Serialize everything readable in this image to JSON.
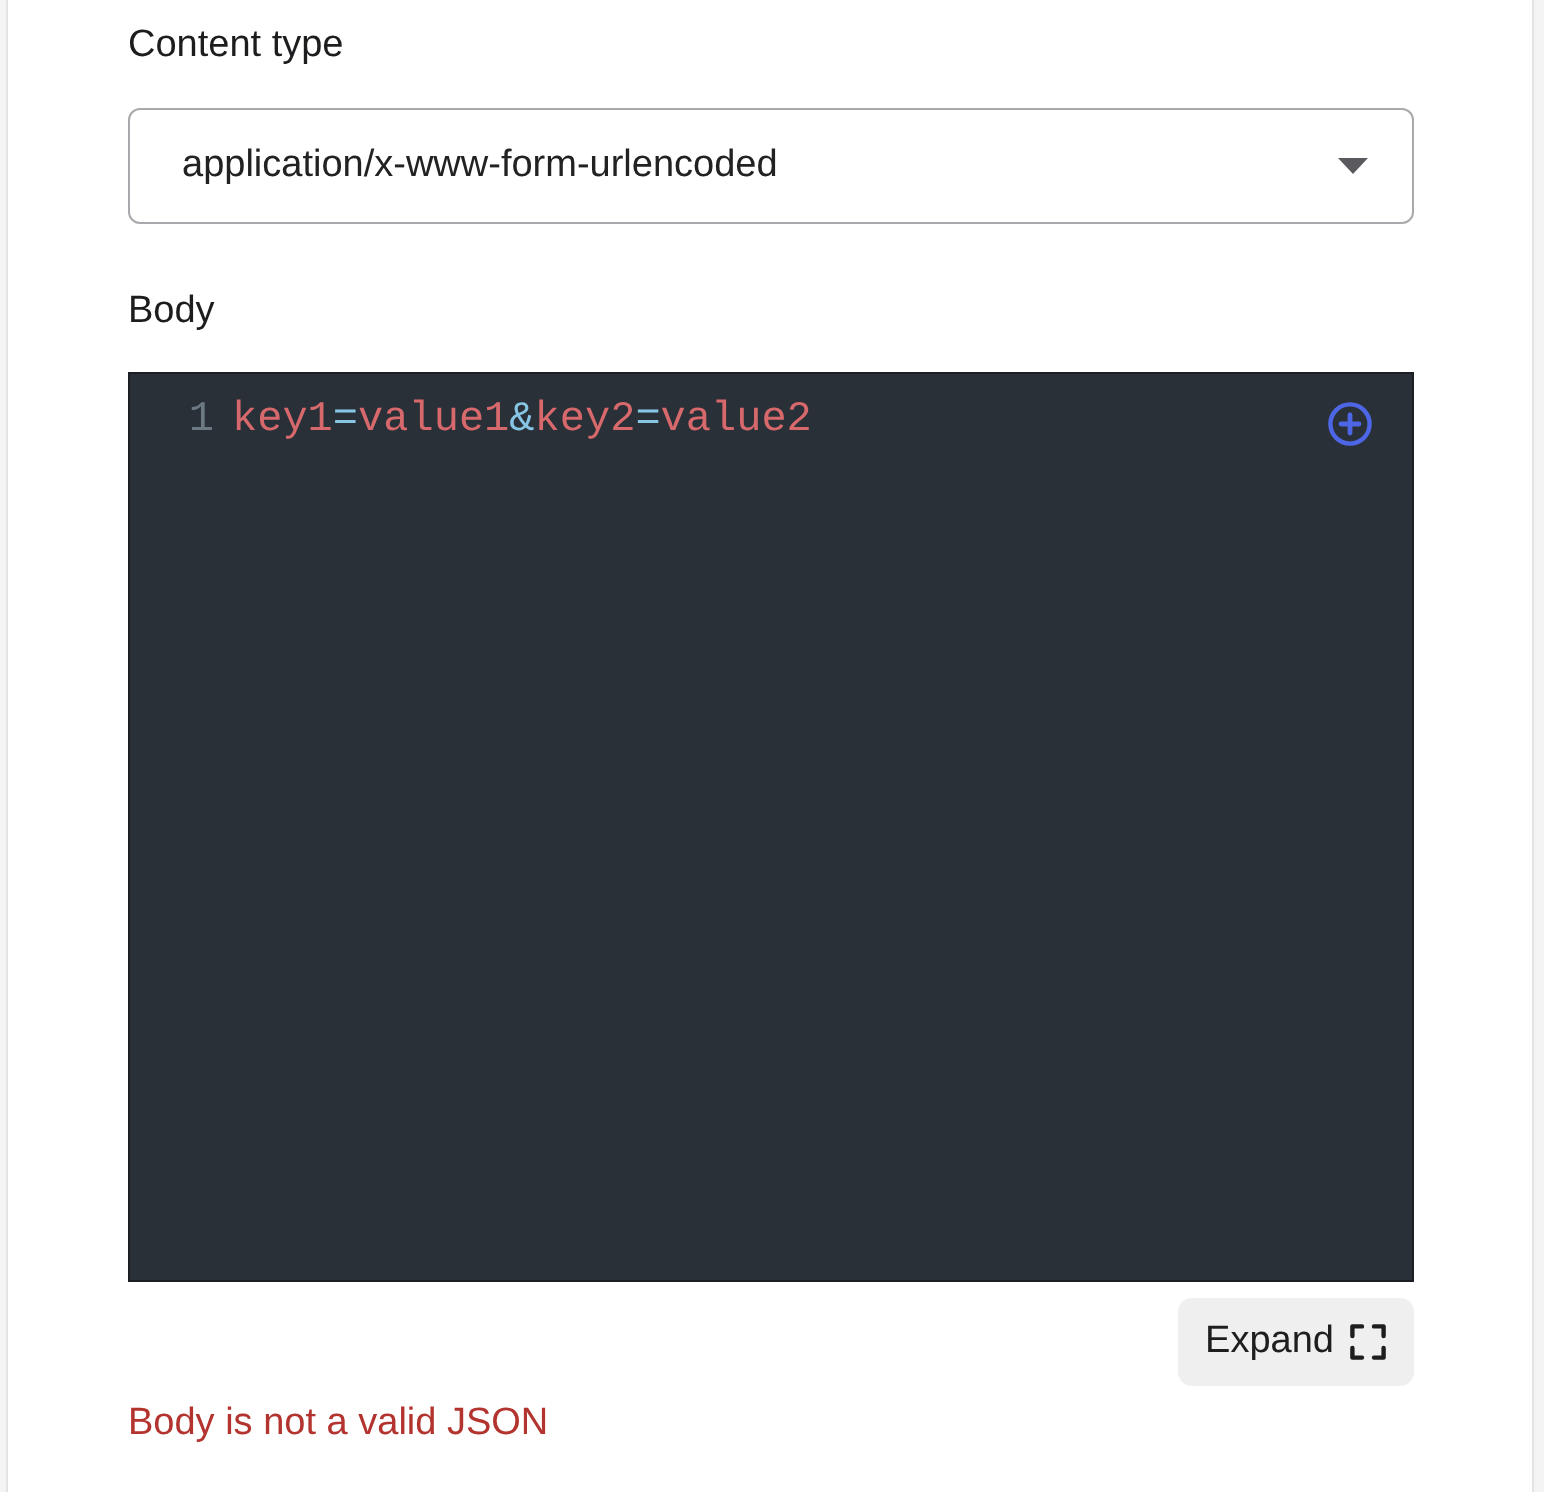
{
  "content_type": {
    "label": "Content type",
    "value": "application/x-www-form-urlencoded"
  },
  "body": {
    "label": "Body",
    "lines": [
      {
        "number": "1",
        "tokens": [
          {
            "kind": "key",
            "text": "key1"
          },
          {
            "kind": "operator",
            "text": "="
          },
          {
            "kind": "value",
            "text": "value1"
          },
          {
            "kind": "operator",
            "text": "&"
          },
          {
            "kind": "key",
            "text": "key2"
          },
          {
            "kind": "operator",
            "text": "="
          },
          {
            "kind": "value",
            "text": "value2"
          }
        ]
      }
    ]
  },
  "expand_button": {
    "label": "Expand"
  },
  "error": "Body is not a valid JSON"
}
